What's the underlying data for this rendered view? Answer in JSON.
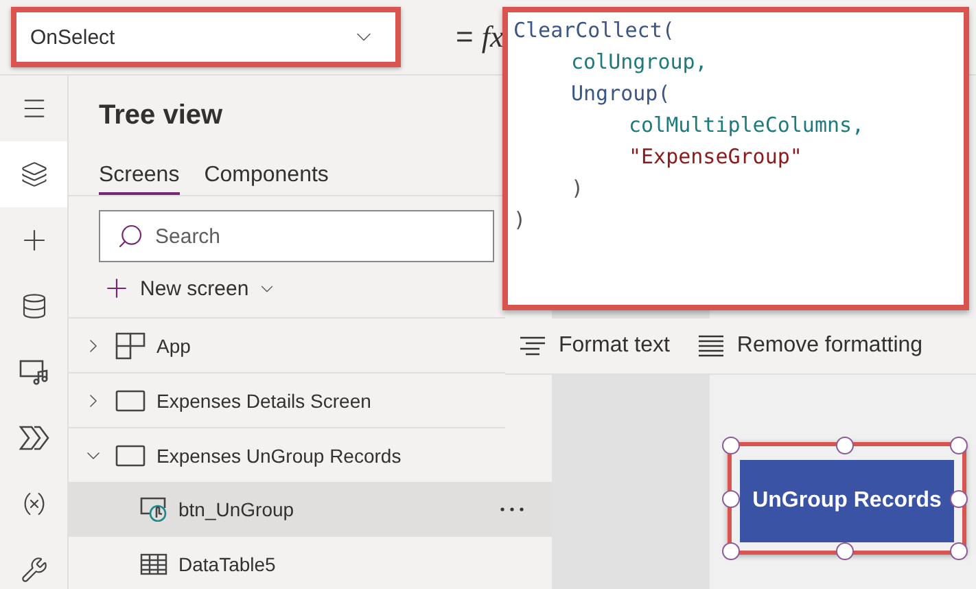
{
  "property_select": {
    "value": "OnSelect"
  },
  "equals": "=",
  "fx": "fx",
  "formula": [
    {
      "text": "ClearCollect(",
      "kind": "function",
      "children": [
        {
          "text": "colUngroup,",
          "kind": "variable"
        },
        {
          "text": "Ungroup(",
          "kind": "function",
          "children": [
            {
              "text": "colMultipleColumns,",
              "kind": "variable"
            },
            {
              "text": "\"ExpenseGroup\"",
              "kind": "string"
            }
          ]
        },
        {
          "text": ")",
          "kind": "punct"
        }
      ]
    },
    {
      "text": ")",
      "kind": "punct"
    }
  ],
  "format_bar": [
    {
      "label": "Format text",
      "kind": "format"
    },
    {
      "label": "Remove formatting",
      "kind": "remove"
    }
  ],
  "rail": [
    {
      "kind": "menu",
      "selected": false
    },
    {
      "kind": "tree",
      "selected": true
    },
    {
      "kind": "insert",
      "selected": false
    },
    {
      "kind": "data",
      "selected": false
    },
    {
      "kind": "media",
      "selected": false
    },
    {
      "kind": "automate",
      "selected": false
    },
    {
      "kind": "variables",
      "selected": false
    },
    {
      "kind": "tools",
      "selected": false
    }
  ],
  "tree_view": {
    "title": "Tree view",
    "tabs": [
      {
        "label": "Screens",
        "selected": true
      },
      {
        "label": "Components",
        "selected": false
      }
    ],
    "search": {
      "placeholder": "Search"
    },
    "new_screen": "New screen",
    "items": [
      {
        "label": "App",
        "kind": "app",
        "expanded": false,
        "selected": false
      },
      {
        "label": "Expenses Details Screen",
        "kind": "screen",
        "expanded": false,
        "selected": false
      },
      {
        "label": "Expenses UnGroup Records",
        "kind": "screen",
        "expanded": true,
        "selected": false,
        "children": [
          {
            "label": "btn_UnGroup",
            "kind": "button",
            "selected": true
          },
          {
            "label": "DataTable5",
            "kind": "table",
            "selected": false
          }
        ]
      }
    ]
  },
  "canvas": {
    "button": {
      "label": "UnGroup Records",
      "selected": true
    }
  }
}
